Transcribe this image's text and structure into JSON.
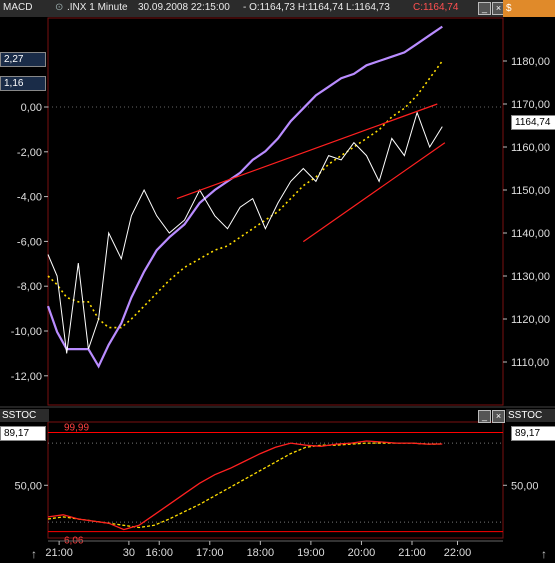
{
  "panels": {
    "main_label": "MACD",
    "sub_label": "SSTOC",
    "sub_label_right": "SSTOC",
    "right_top_tab": "$"
  },
  "header": {
    "symbol": ".INX 1 Minute",
    "datetime": "30.09.2008 22:15:00",
    "ohl": "- O:1164,73 H:1164,74 L:1164,73",
    "close": "C:1164,74"
  },
  "tags": {
    "macd_1": "2,27",
    "macd_2": "1,16",
    "price_last": "1164,74",
    "sstoc_left": "89,17",
    "sstoc_right": "89,17"
  },
  "colors": {
    "price": "#ffffff",
    "ma_fast": "#b98cff",
    "ma_slow": "#ffdd00",
    "trend": "#ff2020",
    "stoch_k": "#ff2020",
    "stoch_d": "#ffdd00",
    "bound": "#ff0000"
  },
  "chart_data": [
    {
      "type": "line",
      "title": "",
      "left_axis_ticks": [
        "0,00",
        "-2,00",
        "-4,00",
        "-6,00",
        "-8,00",
        "-10,00",
        "-12,00"
      ],
      "left_axis_values": [
        0,
        -2,
        -4,
        -6,
        -8,
        -10,
        -12
      ],
      "right_axis_ticks": [
        "1180,00",
        "1170,00",
        "1160,00",
        "1150,00",
        "1140,00",
        "1130,00",
        "1120,00",
        "1110,00"
      ],
      "right_axis_values": [
        1180,
        1170,
        1160,
        1150,
        1140,
        1130,
        1120,
        1110
      ],
      "ylim": [
        1100,
        1190
      ],
      "x_ticks": [
        "21:00",
        "30",
        "16:00",
        "17:00",
        "18:00",
        "19:00",
        "20:00",
        "21:00",
        "22:00"
      ],
      "x": [
        0,
        0.18,
        0.37,
        0.6,
        0.8,
        1.0,
        1.2,
        1.45,
        1.65,
        1.9,
        2.15,
        2.4,
        2.7,
        3.0,
        3.3,
        3.55,
        3.8,
        4.05,
        4.3,
        4.55,
        4.8,
        5.05,
        5.3,
        5.55,
        5.8,
        6.05,
        6.3,
        6.55,
        6.8,
        7.05,
        7.3,
        7.55,
        7.8
      ],
      "series": [
        {
          "values": [
            1135,
            1130,
            1112,
            1133,
            1113,
            1120,
            1140,
            1134,
            1144,
            1150,
            1144,
            1140,
            1143,
            1150,
            1144,
            1141,
            1146,
            1148,
            1141,
            1147,
            1152,
            1155,
            1152,
            1158,
            1157,
            1161,
            1158,
            1152,
            1162,
            1158,
            1168,
            1160,
            1164.74
          ]
        },
        {
          "values": [
            1123,
            1117,
            1113,
            1113,
            1113,
            1109,
            1114,
            1119,
            1125,
            1131,
            1136,
            1139,
            1142,
            1147,
            1150,
            1152,
            1154,
            1157,
            1159,
            1162,
            1166,
            1169,
            1172,
            1174,
            1176,
            1177,
            1179,
            1180,
            1181,
            1182,
            1184,
            1186,
            1188
          ]
        },
        {
          "values": [
            1130,
            1128,
            1125,
            1124,
            1124,
            1120,
            1118,
            1118,
            1120,
            1123,
            1126,
            1129,
            1132,
            1134,
            1136,
            1137,
            1139,
            1141,
            1143,
            1145,
            1148,
            1151,
            1153,
            1156,
            1158,
            1160,
            1162,
            1164,
            1167,
            1169,
            1172,
            1176,
            1180
          ]
        }
      ],
      "trendlines": [
        {
          "x": [
            2.55,
            7.7
          ],
          "values": [
            1148,
            1170
          ]
        },
        {
          "x": [
            5.05,
            7.85
          ],
          "values": [
            1138,
            1161
          ]
        }
      ]
    },
    {
      "type": "line",
      "title": "",
      "y_ticks": [
        "50,00"
      ],
      "y_tick_values": [
        50
      ],
      "upper_bound": "99,99",
      "lower_bound": "6,06",
      "ylim": [
        0,
        110
      ],
      "x": [
        0,
        0.3,
        0.6,
        0.9,
        1.2,
        1.5,
        1.8,
        2.1,
        2.4,
        2.7,
        3.0,
        3.3,
        3.6,
        3.9,
        4.2,
        4.5,
        4.8,
        5.1,
        5.4,
        5.7,
        6.0,
        6.3,
        6.6,
        6.9,
        7.2,
        7.5,
        7.8
      ],
      "series": [
        {
          "values": [
            20,
            22,
            18,
            16,
            14,
            8,
            12,
            22,
            32,
            42,
            52,
            60,
            66,
            73,
            80,
            86,
            90,
            88,
            87,
            89,
            90,
            92,
            91,
            90,
            90,
            89,
            89.17
          ]
        },
        {
          "values": [
            18,
            20,
            18,
            16,
            14,
            12,
            10,
            12,
            18,
            25,
            32,
            40,
            48,
            56,
            64,
            72,
            80,
            86,
            88,
            88,
            89,
            90,
            90,
            90,
            90,
            89,
            89.17
          ]
        }
      ]
    }
  ]
}
